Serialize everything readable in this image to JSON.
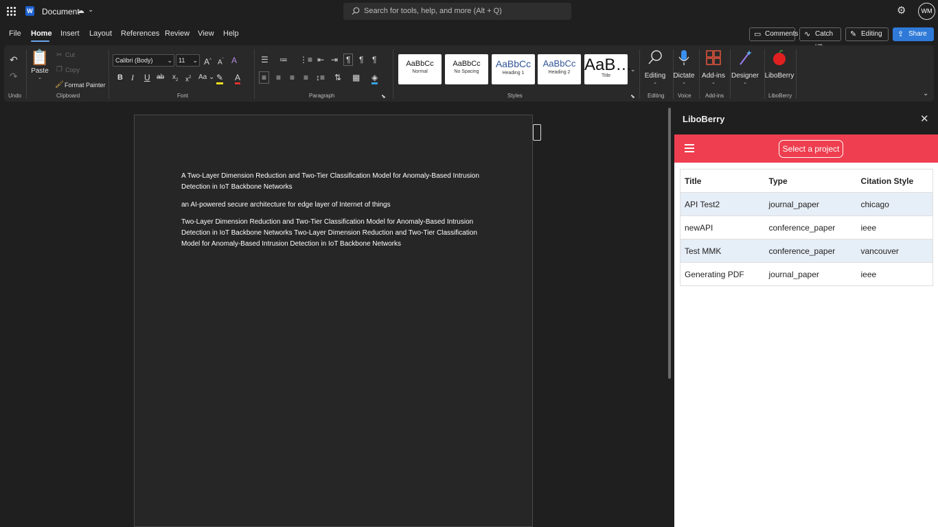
{
  "titlebar": {
    "doc_title": "Document",
    "status_icon": "cloud-sync-icon",
    "search_placeholder": "Search for tools, help, and more (Alt + Q)",
    "avatar_initials": "WM"
  },
  "menu": {
    "items": [
      "File",
      "Home",
      "Insert",
      "Layout",
      "References",
      "Review",
      "View",
      "Help"
    ],
    "active": "Home"
  },
  "topright": {
    "comments": "Comments",
    "catchup": "Catch up",
    "editing": "Editing",
    "share": "Share"
  },
  "ribbon": {
    "undo_label": "Undo",
    "clipboard": {
      "paste": "Paste",
      "cut": "Cut",
      "copy": "Copy",
      "format_painter": "Format Painter",
      "label": "Clipboard"
    },
    "font": {
      "name": "Calibri (Body)",
      "size": "11",
      "label": "Font",
      "change_case": "Aa"
    },
    "paragraph_label": "Paragraph",
    "styles": {
      "label": "Styles",
      "cards": [
        {
          "preview": "AaBbCc",
          "name": "Normal"
        },
        {
          "preview": "AaBbCc",
          "name": "No Spacing"
        },
        {
          "preview": "AaBbCc",
          "name": "Heading 1"
        },
        {
          "preview": "AaBbCc",
          "name": "Heading 2"
        },
        {
          "preview": "AaB…",
          "name": "Title"
        }
      ]
    },
    "editing": {
      "btn": "Editing",
      "label": "Editing"
    },
    "voice": {
      "btn": "Dictate",
      "label": "Voice"
    },
    "addins": {
      "btn": "Add-ins",
      "label": "Add-ins"
    },
    "designer": {
      "btn": "Designer"
    },
    "liboberry": {
      "btn": "LiboBerry",
      "label": "LiboBerry"
    }
  },
  "document": {
    "paragraphs": [
      "A Two-Layer Dimension Reduction and Two-Tier Classification Model for Anomaly-Based Intrusion Detection in IoT Backbone Networks",
      "an AI-powered secure architecture for edge layer of Internet of things",
      "Two-Layer Dimension Reduction and Two-Tier Classification Model for Anomaly-Based Intrusion Detection in IoT Backbone Networks Two-Layer Dimension Reduction and Two-Tier Classification Model for Anomaly-Based Intrusion Detection in IoT Backbone Networks"
    ]
  },
  "pane": {
    "title": "LiboBerry",
    "select_project": "Select a project",
    "columns": [
      "Title",
      "Type",
      "Citation Style"
    ],
    "rows": [
      {
        "title": "API Test2",
        "type": "journal_paper",
        "style": "chicago"
      },
      {
        "title": "newAPI",
        "type": "conference_paper",
        "style": "ieee"
      },
      {
        "title": "Test MMK",
        "type": "conference_paper",
        "style": "vancouver"
      },
      {
        "title": "Generating PDF",
        "type": "journal_paper",
        "style": "ieee"
      }
    ],
    "accent": "#ee3e4f"
  }
}
